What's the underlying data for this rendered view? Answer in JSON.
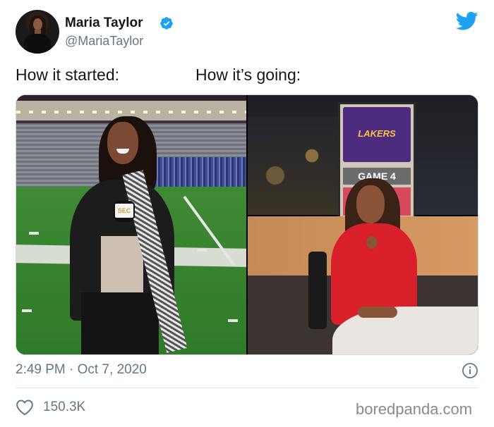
{
  "author": {
    "name": "Maria Taylor",
    "handle": "@MariaTaylor",
    "verified": true
  },
  "tweet": {
    "text_left": "How it started:",
    "text_right": "How it’s going:"
  },
  "media": {
    "left_photo": {
      "mic_logo": "SEC"
    },
    "right_photo": {
      "screen_title": "LAKERS",
      "screen_caption": "GAME 4"
    }
  },
  "footer": {
    "timestamp": "2:49 PM · Oct 7, 2020",
    "likes": "150.3K",
    "watermark": "boredpanda.com"
  },
  "colors": {
    "twitter_blue": "#1da1f2",
    "secondary_text": "#657786"
  },
  "icons": {
    "verified": "verified-badge-icon",
    "logo": "twitter-bird-icon",
    "info": "info-icon",
    "like": "heart-icon"
  }
}
